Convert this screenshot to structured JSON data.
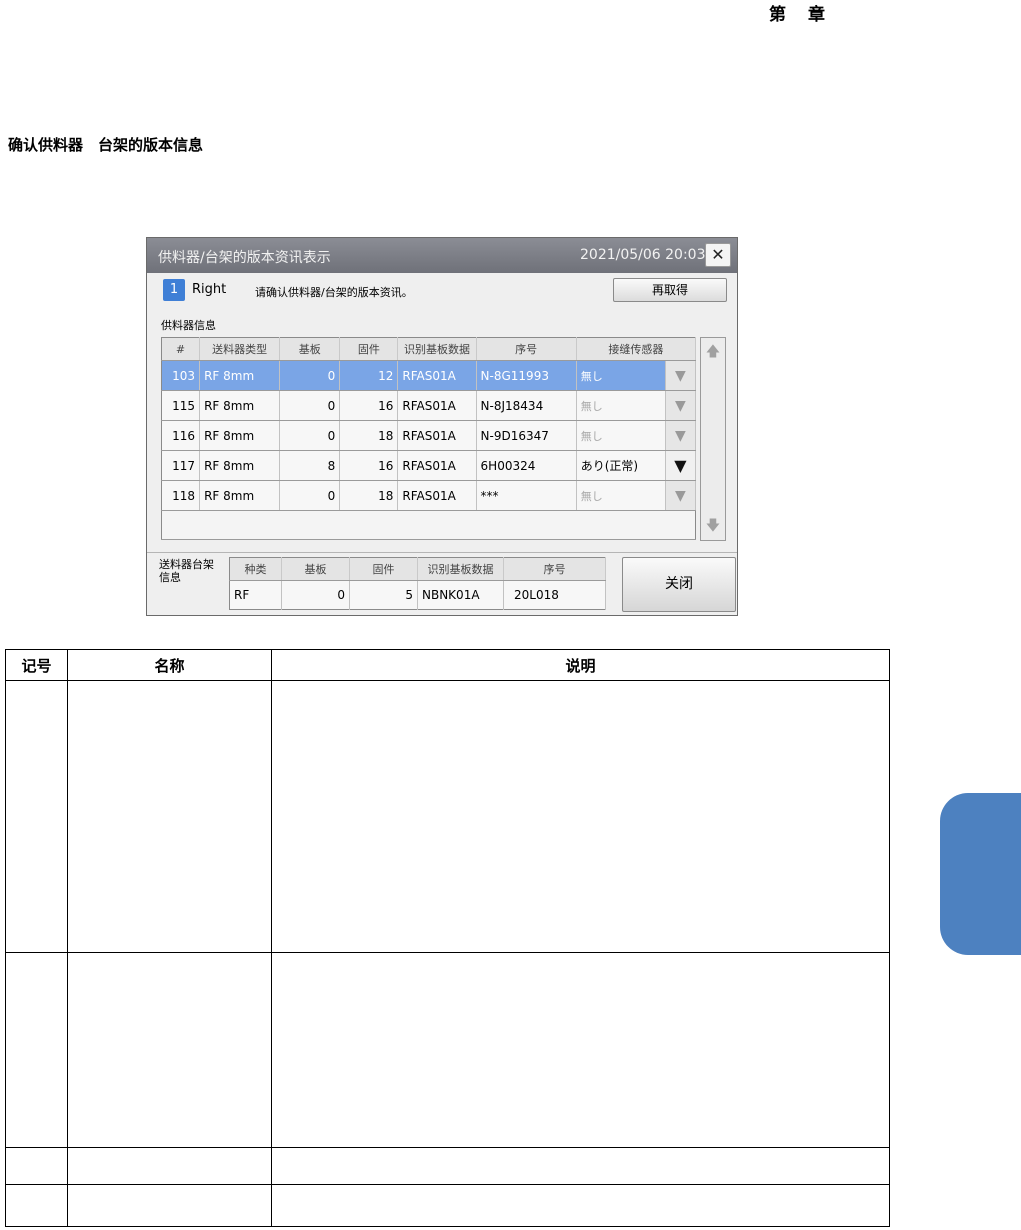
{
  "header": {
    "chapter_left": "第",
    "chapter_right": "章"
  },
  "section_title": "确认供料器　台架的版本信息",
  "window": {
    "title": "供料器/台架的版本资讯表示",
    "datetime": "2021/05/06 20:03",
    "close_symbol": "✕",
    "lane_number": "1",
    "lane_name": "Right",
    "message": "请确认供料器/台架的版本资讯。",
    "reload_label": "再取得",
    "feeder_info_label": "供料器信息",
    "columns": [
      "#",
      "送料器类型",
      "基板",
      "固件",
      "识别基板数据",
      "序号",
      "接缝传感器"
    ],
    "rows": [
      {
        "no": "103",
        "type": "RF 8mm",
        "board": "0",
        "firmware": "12",
        "id_board": "RFAS01A",
        "serial": "N-8G11993",
        "sensor": "無し",
        "selected": true
      },
      {
        "no": "115",
        "type": "RF 8mm",
        "board": "0",
        "firmware": "16",
        "id_board": "RFAS01A",
        "serial": "N-8J18434",
        "sensor": "無し",
        "selected": false
      },
      {
        "no": "116",
        "type": "RF 8mm",
        "board": "0",
        "firmware": "18",
        "id_board": "RFAS01A",
        "serial": "N-9D16347",
        "sensor": "無し",
        "selected": false
      },
      {
        "no": "117",
        "type": "RF 8mm",
        "board": "8",
        "firmware": "16",
        "id_board": "RFAS01A",
        "serial": "6H00324",
        "sensor": "あり(正常)",
        "selected": false
      },
      {
        "no": "118",
        "type": "RF 8mm",
        "board": "0",
        "firmware": "18",
        "id_board": "RFAS01A",
        "serial": "***",
        "sensor": "無し",
        "selected": false
      }
    ],
    "dropdown_symbol": "▼",
    "scroll_up_symbol": "🡅",
    "scroll_down_symbol": "🡇",
    "rack_label": "送料器台架信息",
    "rack_columns": [
      "种类",
      "基板",
      "固件",
      "识别基板数据",
      "序号"
    ],
    "rack_row": {
      "kind": "RF",
      "board": "0",
      "firmware": "5",
      "id_board": "NBNK01A",
      "serial": "20L018"
    },
    "close_label": "关闭"
  },
  "desc_table": {
    "col_symbol": "记号",
    "col_name": "名称",
    "col_desc": "说明"
  },
  "colors": {
    "accent": "#3f7fd6",
    "selected_row": "#7aa5e6",
    "side_tab": "#4d81c0"
  }
}
